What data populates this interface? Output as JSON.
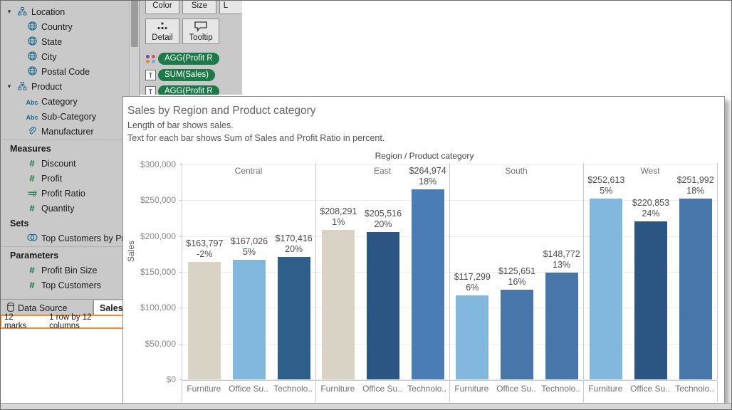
{
  "sidebar": {
    "groups": [
      {
        "type": "hierarchy",
        "icon": "hierarchy-icon",
        "label": "Location",
        "expanded": true
      },
      {
        "type": "field",
        "icon": "globe-icon",
        "label": "Country"
      },
      {
        "type": "field",
        "icon": "globe-icon",
        "label": "State"
      },
      {
        "type": "field",
        "icon": "globe-icon",
        "label": "City"
      },
      {
        "type": "field",
        "icon": "globe-icon",
        "label": "Postal Code"
      },
      {
        "type": "hierarchy",
        "icon": "hierarchy-icon",
        "label": "Product",
        "expanded": true
      },
      {
        "type": "field",
        "icon": "abc-icon",
        "label": "Category"
      },
      {
        "type": "field",
        "icon": "abc-icon",
        "label": "Sub-Category"
      },
      {
        "type": "field",
        "icon": "paperclip-icon",
        "label": "Manufacturer"
      }
    ],
    "measures_header": "Measures",
    "measures": [
      {
        "icon": "hash-icon",
        "label": "Discount"
      },
      {
        "icon": "hash-icon",
        "label": "Profit"
      },
      {
        "icon": "calc-hash-icon",
        "label": "Profit Ratio"
      },
      {
        "icon": "hash-icon",
        "label": "Quantity"
      }
    ],
    "sets_header": "Sets",
    "sets": [
      {
        "icon": "set-icon",
        "label": "Top Customers by Profit"
      }
    ],
    "parameters_header": "Parameters",
    "parameters": [
      {
        "icon": "hash-icon",
        "label": "Profit Bin Size"
      },
      {
        "icon": "hash-icon",
        "label": "Top Customers"
      }
    ]
  },
  "marks_card": {
    "buttons": [
      {
        "name": "color-button",
        "label": "Color"
      },
      {
        "name": "size-button",
        "label": "Size"
      },
      {
        "name": "label-button",
        "label": "L"
      },
      {
        "name": "detail-button",
        "label": "Detail",
        "icon": "detail-dots-icon"
      },
      {
        "name": "tooltip-button",
        "label": "Tooltip",
        "icon": "tooltip-icon"
      }
    ],
    "pills": [
      {
        "icon": "color-dots-icon",
        "label": "AGG(Profit R"
      },
      {
        "icon": "text-icon",
        "label": "SUM(Sales)"
      },
      {
        "icon": "text-icon",
        "label": "AGG(Profit R"
      }
    ]
  },
  "tabs": {
    "data_source": "Data Source",
    "data_source_icon": "database-icon",
    "sheet": "Sales"
  },
  "status_bar": {
    "marks": "12 marks",
    "dimensions": "1 row by 12 columns",
    "highlight_color": "#f28c28"
  },
  "viz": {
    "title": "Sales by Region and Product category",
    "subtitle1": "Length of bar shows sales.",
    "subtitle2": "Text for each bar shows Sum of Sales and Profit Ratio in percent."
  },
  "chart_data": {
    "type": "bar",
    "title": "Sales by Region and Product category",
    "column_field_label": "Region / Product category",
    "ylabel": "Sales",
    "ylim": [
      0,
      300000
    ],
    "yticks": [
      "$0",
      "$50,000",
      "$100,000",
      "$150,000",
      "$200,000",
      "$250,000",
      "$300,000"
    ],
    "ytick_values": [
      0,
      50000,
      100000,
      150000,
      200000,
      250000,
      300000
    ],
    "grid": true,
    "legend": "none",
    "regions": [
      "Central",
      "East",
      "South",
      "West"
    ],
    "categories": [
      "Furniture",
      "Office Su..",
      "Technolo.."
    ],
    "bars": [
      {
        "region": "Central",
        "category": "Furniture",
        "sales": 163797,
        "sales_label": "$163,797",
        "profit_ratio": "-2%",
        "color": "#d8d3c5"
      },
      {
        "region": "Central",
        "category": "Office Su..",
        "sales": 167026,
        "sales_label": "$167,026",
        "profit_ratio": "5%",
        "color": "#82b7de"
      },
      {
        "region": "Central",
        "category": "Technolo..",
        "sales": 170416,
        "sales_label": "$170,416",
        "profit_ratio": "20%",
        "color": "#2e5f8a"
      },
      {
        "region": "East",
        "category": "Furniture",
        "sales": 208291,
        "sales_label": "$208,291",
        "profit_ratio": "1%",
        "color": "#d8d3c5"
      },
      {
        "region": "East",
        "category": "Office Su..",
        "sales": 205516,
        "sales_label": "$205,516",
        "profit_ratio": "20%",
        "color": "#2b5582"
      },
      {
        "region": "East",
        "category": "Technolo..",
        "sales": 264974,
        "sales_label": "$264,974",
        "profit_ratio": "18%",
        "color": "#4a7db5"
      },
      {
        "region": "South",
        "category": "Furniture",
        "sales": 117299,
        "sales_label": "$117,299",
        "profit_ratio": "6%",
        "color": "#82b7de"
      },
      {
        "region": "South",
        "category": "Office Su..",
        "sales": 125651,
        "sales_label": "$125,651",
        "profit_ratio": "16%",
        "color": "#4776ab"
      },
      {
        "region": "South",
        "category": "Technolo..",
        "sales": 148772,
        "sales_label": "$148,772",
        "profit_ratio": "13%",
        "color": "#4776ab"
      },
      {
        "region": "West",
        "category": "Furniture",
        "sales": 252613,
        "sales_label": "$252,613",
        "profit_ratio": "5%",
        "color": "#82b7de"
      },
      {
        "region": "West",
        "category": "Office Su..",
        "sales": 220853,
        "sales_label": "$220,853",
        "profit_ratio": "24%",
        "color": "#2b5582"
      },
      {
        "region": "West",
        "category": "Technolo..",
        "sales": 251992,
        "sales_label": "$251,992",
        "profit_ratio": "18%",
        "color": "#4776ab"
      }
    ]
  }
}
